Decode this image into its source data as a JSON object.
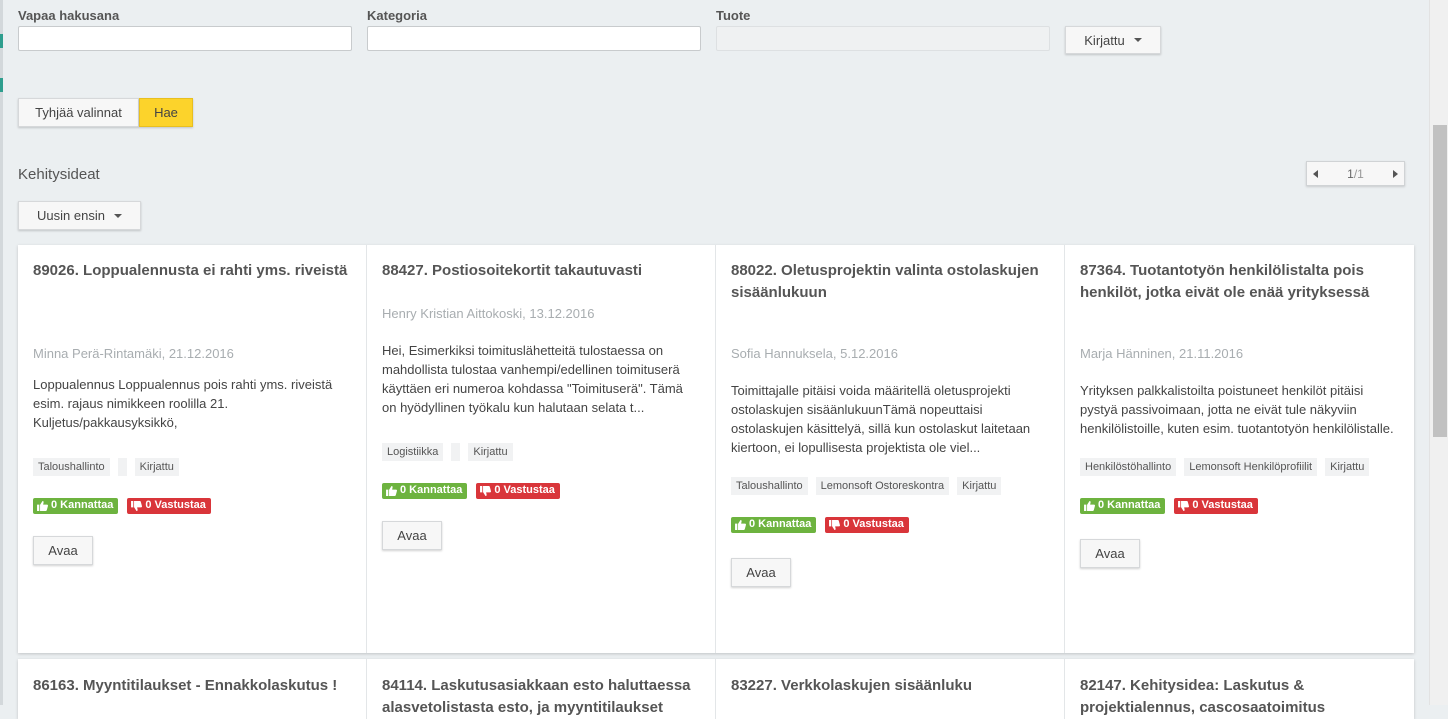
{
  "filters": {
    "free_search": {
      "label": "Vapaa hakusana",
      "value": ""
    },
    "category": {
      "label": "Kategoria",
      "value": ""
    },
    "product": {
      "label": "Tuote",
      "value": ""
    },
    "status_dropdown": "Kirjattu"
  },
  "actions": {
    "clear": "Tyhjää valinnat",
    "search": "Hae"
  },
  "section": {
    "title": "Kehitysideat",
    "sort": "Uusin ensin"
  },
  "pager": {
    "current": "1",
    "total": "/1"
  },
  "colors": {
    "accent_yellow": "#fcd32b",
    "vote_up": "#6db33f",
    "vote_down": "#d9353a"
  },
  "icons": {
    "up": "thumbs-up-icon",
    "down": "thumbs-down-icon",
    "caret": "caret-down-icon"
  },
  "cards": [
    {
      "title": "89026. Loppualennusta ei rahti yms. riveistä",
      "meta": "Minna Perä-Rintamäki, 21.12.2016",
      "desc": "Loppualennus Loppualennus pois rahti yms. riveistä esim. rajaus nimikkeen roolilla 21. Kuljetus/pakkausyksikkö,",
      "tags": [
        "Taloushallinto",
        "",
        "Kirjattu"
      ],
      "upvotes": "0 Kannattaa",
      "downvotes": "0 Vastustaa",
      "open": "Avaa"
    },
    {
      "title": "88427. Postiosoitekortit takautuvasti",
      "meta": "Henry Kristian Aittokoski, 13.12.2016",
      "desc": "Hei, Esimerkiksi toimituslähetteitä tulostaessa on mahdollista tulostaa vanhempi/edellinen toimituserä käyttäen eri numeroa kohdassa \"Toimituserä\". Tämä on hyödyllinen työkalu kun halutaan selata t...",
      "tags": [
        "Logistiikka",
        "",
        "Kirjattu"
      ],
      "upvotes": "0 Kannattaa",
      "downvotes": "0 Vastustaa",
      "open": "Avaa"
    },
    {
      "title": "88022. Oletusprojektin valinta ostolaskujen sisäänlukuun",
      "meta": "Sofia Hannuksela, 5.12.2016",
      "desc": "Toimittajalle pitäisi voida määritellä oletusprojekti ostolaskujen sisäänlukuunTämä nopeuttaisi ostolaskujen käsittelyä, sillä kun ostolaskut laitetaan kiertoon, ei lopullisesta projektista ole viel...",
      "tags": [
        "Taloushallinto",
        "Lemonsoft Ostoreskontra",
        "Kirjattu"
      ],
      "upvotes": "0 Kannattaa",
      "downvotes": "0 Vastustaa",
      "open": "Avaa"
    },
    {
      "title": "87364. Tuotantotyön henkilölistalta pois henkilöt, jotka eivät ole enää yrityksessä",
      "meta": "Marja Hänninen, 21.11.2016",
      "desc": "Yrityksen palkkalistoilta poistuneet henkilöt pitäisi pystyä passivoimaan, jotta ne eivät tule näkyviin henkilölistoille, kuten esim. tuotantotyön henkilölistalle.",
      "tags": [
        "Henkilöstöhallinto",
        "Lemonsoft Henkilöprofiilit",
        "Kirjattu"
      ],
      "upvotes": "0 Kannattaa",
      "downvotes": "0 Vastustaa",
      "open": "Avaa"
    }
  ],
  "cards_row2": [
    {
      "title": "86163. Myyntitilaukset - Ennakkolaskutus !"
    },
    {
      "title": "84114. Laskutusasiakkaan esto haluttaessa alasvetolistasta esto, ja myyntitilaukset"
    },
    {
      "title": "83227. Verkkolaskujen sisäänluku"
    },
    {
      "title": "82147. Kehitysidea: Laskutus & projektialennus, cascosaatoimitus"
    }
  ]
}
